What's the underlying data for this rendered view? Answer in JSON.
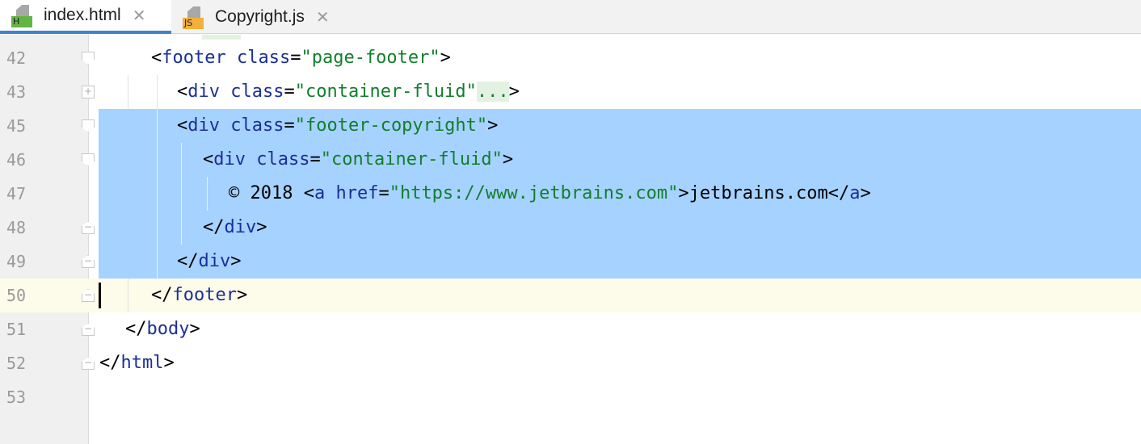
{
  "tabs": [
    {
      "label": "index.html",
      "icon": "html-file-icon",
      "badge": "H",
      "active": true
    },
    {
      "label": "Copyright.js",
      "icon": "js-file-icon",
      "badge": "JS",
      "active": false
    }
  ],
  "close_glyph": "✕",
  "lines": [
    {
      "no": "42"
    },
    {
      "no": "43"
    },
    {
      "no": "45"
    },
    {
      "no": "46"
    },
    {
      "no": "47"
    },
    {
      "no": "48"
    },
    {
      "no": "49"
    },
    {
      "no": "50"
    },
    {
      "no": "51"
    },
    {
      "no": "52"
    },
    {
      "no": "53"
    }
  ],
  "code": {
    "footer_tag": "footer",
    "footer_class_attr": "class",
    "footer_class_val": "\"page-footer\"",
    "div_tag": "div",
    "class_attr": "class",
    "container_val": "\"container-fluid\"",
    "folded": "...",
    "copyright_val": "\"footer-copyright\"",
    "copyright_text": "© 2018 ",
    "a_tag": "a",
    "href_attr": "href",
    "href_val": "\"https://www.jetbrains.com\"",
    "link_text": "jetbrains.com",
    "body_tag": "body",
    "html_tag": "html"
  },
  "colors": {
    "selection": "#a6d2ff",
    "caret_line": "#fdfbe9",
    "tag": "#1a2f99",
    "string": "#127e2d",
    "active_tab_underline": "#4083c9"
  }
}
